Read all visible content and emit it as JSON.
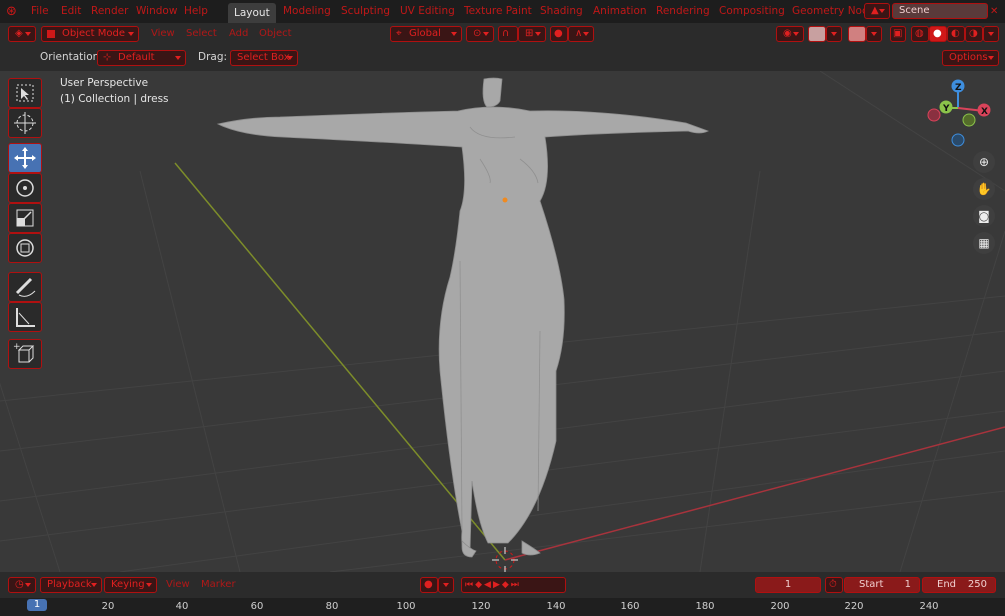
{
  "menu": {
    "items": [
      "File",
      "Edit",
      "Render",
      "Window",
      "Help"
    ]
  },
  "workspaces": [
    "Layout",
    "Modeling",
    "Sculpting",
    "UV Editing",
    "Texture Paint",
    "Shading",
    "Animation",
    "Rendering",
    "Compositing",
    "Geometry Noc"
  ],
  "scene": {
    "name": "Scene"
  },
  "header": {
    "mode": "Object Mode",
    "menus": [
      "View",
      "Select",
      "Add",
      "Object"
    ],
    "transform_orientation": "Global"
  },
  "tool_settings": {
    "orientation_label": "Orientation:",
    "orientation_value": "Default",
    "drag_label": "Drag:",
    "drag_value": "Select Box",
    "options": "Options"
  },
  "viewport": {
    "view_name": "User Perspective",
    "collection_info": "(1) Collection | dress",
    "gizmo": {
      "z": "Z",
      "y": "Y",
      "x": "X"
    }
  },
  "timeline": {
    "menus": [
      "Playback",
      "Keying",
      "View",
      "Marker"
    ],
    "current_frame": "1",
    "start_label": "Start",
    "start_value": "1",
    "end_label": "End",
    "end_value": "250",
    "ruler_current": "1",
    "ruler_ticks": [
      "20",
      "40",
      "60",
      "80",
      "100",
      "120",
      "140",
      "160",
      "180",
      "200",
      "220",
      "240"
    ]
  },
  "colors": {
    "accent_red": "#d01818",
    "active_blue": "#4772b3",
    "x_axis": "#d9435a",
    "y_axis": "#8bc34a",
    "z_axis": "#3e8ede"
  }
}
